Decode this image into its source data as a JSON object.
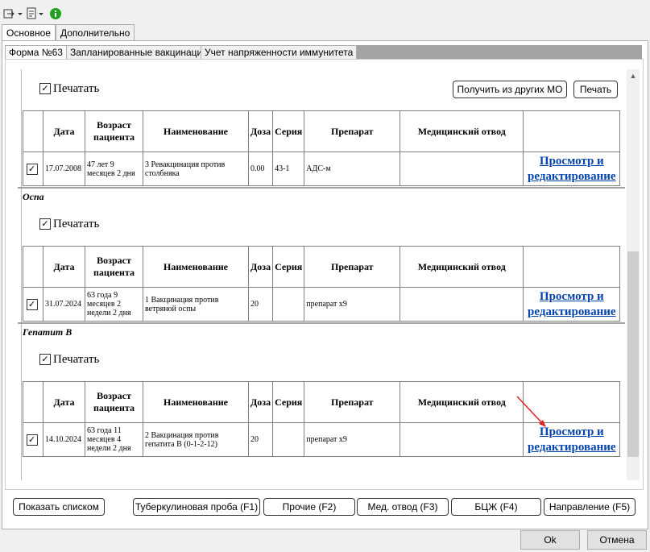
{
  "toolbar": {
    "icons": [
      "dropdown-export-icon",
      "dropdown-document-icon",
      "info-icon"
    ]
  },
  "tabs_main": [
    {
      "label": "Основное"
    },
    {
      "label": "Дополнительно"
    }
  ],
  "tabs_sub": [
    {
      "label": "Форма №63"
    },
    {
      "label": "Запланированные вакцинации"
    },
    {
      "label": "Учет напряженности иммунитета"
    }
  ],
  "print_label": "Печатать",
  "top_buttons": {
    "get_from_other": "Получить из других МО",
    "print": "Печать"
  },
  "columns": [
    "Дата",
    "Возраст пациента",
    "Наименование",
    "Доза",
    "Серия",
    "Препарат",
    "Медицинский отвод"
  ],
  "link_label": "Просмотр и редактирование",
  "sections": [
    {
      "title": "",
      "row": {
        "checked": true,
        "date": "17.07.2008",
        "age": "47 лет 9 месяцев 2 дня",
        "name": "3 Ревакцинация против столбняка",
        "dose": "0.00",
        "series": "43-1",
        "drug": "АДС-м",
        "medical_withdrawal": ""
      }
    },
    {
      "title": "Оспа",
      "row": {
        "checked": true,
        "date": "31.07.2024",
        "age": "63 года 9 месяцев 2 недели 2 дня",
        "name": "1 Вакцинация против ветряной оспы",
        "dose": "20",
        "series": "",
        "drug": "препарат х9",
        "medical_withdrawal": ""
      }
    },
    {
      "title": "Гепатит В",
      "row": {
        "checked": true,
        "date": "14.10.2024",
        "age": "63 года 11 месяцев 4 недели 2 дня",
        "name": "2 Вакцинация против гепатита В (0-1-2-12)",
        "dose": "20",
        "series": "",
        "drug": "препарат х9",
        "medical_withdrawal": ""
      }
    }
  ],
  "bottom_buttons": {
    "show_list": "Показать списком",
    "tuberculin": "Туберкулиновая проба (F1)",
    "other": "Прочие (F2)",
    "med_withdrawal": "Мед. отвод (F3)",
    "bcg": "БЦЖ (F4)",
    "referral": "Направление (F5)"
  },
  "dialog_buttons": {
    "ok": "Ok",
    "cancel": "Отмена"
  }
}
